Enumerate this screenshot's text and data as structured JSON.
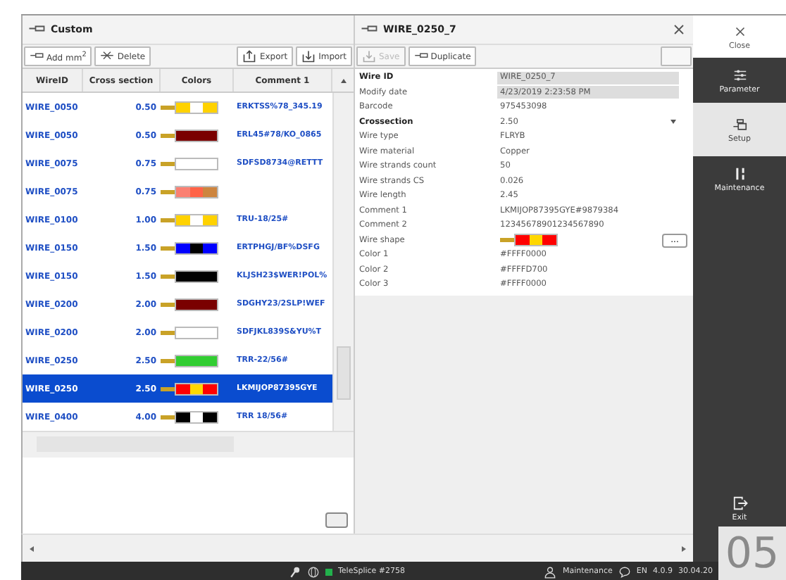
{
  "list_panel": {
    "title": "Custom",
    "toolbar": [
      {
        "label": "Add mm$^{2}$",
        "disabled": false
      },
      {
        "label": "Delete",
        "disabled": false
      },
      {
        "label": "Export",
        "disabled": false
      },
      {
        "label": "Import",
        "disabled": false
      }
    ],
    "columns": [
      "WireID",
      "Cross section",
      "Colors",
      "Comment 1"
    ],
    "rows": [
      {
        "wire_id": "WIRE_0050",
        "cross_section": "0.50",
        "colors": [
          {
            "color": "#ffd200"
          },
          {
            "color": "#ffffff"
          },
          {
            "color": "#ffd200"
          }
        ],
        "comment": "ERKTSS%78_345.19",
        "selected": false
      },
      {
        "wire_id": "WIRE_0050",
        "cross_section": "0.50",
        "colors": [
          {
            "color": "#7a0000"
          }
        ],
        "comment": "ERL45#78/KO_0865",
        "selected": false
      },
      {
        "wire_id": "WIRE_0075",
        "cross_section": "0.75",
        "colors": [
          {
            "color": "#ffffff"
          }
        ],
        "comment": "SDFSD8734@RETTT",
        "selected": false
      },
      {
        "wire_id": "WIRE_0075",
        "cross_section": "0.75",
        "colors": [
          {
            "color": "#fa8072"
          },
          {
            "color": "#ff6347"
          },
          {
            "color": "#cd853f"
          }
        ],
        "selected": false
      },
      {
        "wire_id": "WIRE_0100",
        "cross_section": "1.00",
        "colors": [
          {
            "color": "#ffd200"
          },
          {
            "color": "#ffffff"
          },
          {
            "color": "#ffd200"
          }
        ],
        "comment": "TRU-18/25#",
        "selected": false
      },
      {
        "wire_id": "WIRE_0150",
        "cross_section": "1.50",
        "colors": [
          {
            "color": "#0000ff"
          },
          {
            "color": "#000000"
          },
          {
            "color": "#0000ff"
          }
        ],
        "comment": "ERTPHGJ/BF%DSFG",
        "selected": false
      },
      {
        "wire_id": "WIRE_0150",
        "cross_section": "1.50",
        "colors": [
          {
            "color": "#000000"
          }
        ],
        "comment": "KLJSH23$WER!POL%",
        "selected": false
      },
      {
        "wire_id": "WIRE_0200",
        "cross_section": "2.00",
        "colors": [
          {
            "color": "#7a0000"
          }
        ],
        "comment": "SDGHY23/2SLP!WEF",
        "selected": false
      },
      {
        "wire_id": "WIRE_0200",
        "cross_section": "2.00",
        "colors": [
          {
            "color": "#ffffff"
          }
        ],
        "comment": "SDFJKL839S&YU%T",
        "selected": false
      },
      {
        "wire_id": "WIRE_0250",
        "cross_section": "2.50",
        "colors": [
          {
            "color": "#32cd32"
          }
        ],
        "comment": "TRR-22/56#",
        "selected": false
      },
      {
        "wire_id": "WIRE_0250",
        "cross_section": "2.50",
        "colors": [
          {
            "color": "#ff0000"
          },
          {
            "color": "#ffd700"
          },
          {
            "color": "#ff0000"
          }
        ],
        "comment": "LKMIJOP87395GYE",
        "selected": true
      },
      {
        "wire_id": "WIRE_0400",
        "cross_section": "4.00",
        "colors": [
          {
            "color": "#000000"
          },
          {
            "color": "#ffffff"
          },
          {
            "color": "#000000"
          }
        ],
        "comment": "TRR 18/56#",
        "selected": false
      }
    ]
  },
  "detail_panel": {
    "title": "WIRE_0250_7",
    "toolbar": [
      {
        "label": "Save",
        "disabled": true
      },
      {
        "label": "Duplicate",
        "disabled": false
      }
    ],
    "fields": [
      {
        "label": "Wire ID",
        "value": "WIRE_0250_7",
        "kind": "readonly",
        "bold": true
      },
      {
        "label": "Modify date",
        "value": "4/23/2019 2:23:58 PM",
        "kind": "readonly",
        "bold": false
      },
      {
        "label": "Barcode",
        "value": "975453098",
        "kind": "text",
        "bold": false
      },
      {
        "label": "Crossection",
        "value": "2.50",
        "kind": "dropdown",
        "bold": true
      },
      {
        "label": "Wire type",
        "value": "FLRYB",
        "kind": "text",
        "bold": false
      },
      {
        "label": "Wire material",
        "value": "Copper",
        "kind": "text",
        "bold": false
      },
      {
        "label": "Wire strands count",
        "value": "50",
        "kind": "text",
        "bold": false
      },
      {
        "label": "Wire strands CS",
        "value": "0.026",
        "kind": "text",
        "bold": false
      },
      {
        "label": "Wire length",
        "value": "2.45",
        "kind": "text",
        "bold": false
      },
      {
        "label": "Comment 1",
        "value": "LKMIJOP87395GYE#9879384",
        "kind": "text",
        "bold": false
      },
      {
        "label": "Comment 2",
        "value": "12345678901234567890",
        "kind": "text",
        "bold": false
      },
      {
        "label": "Wire shape",
        "colors": [
          {
            "color": "#ff0000"
          },
          {
            "color": "#ffd700"
          },
          {
            "color": "#ff0000"
          }
        ],
        "button": "...",
        "kind": "shape",
        "bold": false
      },
      {
        "label": "Color 1",
        "value": "#FFFF0000",
        "kind": "text",
        "bold": false
      },
      {
        "label": "Color 2",
        "value": "#FFFFD700",
        "kind": "text",
        "bold": false
      },
      {
        "label": "Color 3",
        "value": "#FFFF0000",
        "kind": "text",
        "bold": false
      }
    ]
  },
  "sidebar": [
    {
      "label": "Close",
      "kind": "close",
      "selected": false
    },
    {
      "label": "Parameter",
      "kind": "parameter",
      "selected": false
    },
    {
      "label": "Setup",
      "kind": "setup",
      "selected": true
    },
    {
      "label": "Maintenance",
      "kind": "maintenance",
      "selected": false
    },
    {
      "label": "Exit",
      "kind": "exit",
      "selected": false
    }
  ],
  "status_bar": {
    "machine": "TeleSplice #2758",
    "online": true,
    "user": "Maintenance",
    "language": "EN",
    "version": "4.0.9",
    "date": "30.04.20"
  },
  "page_badge": "05"
}
